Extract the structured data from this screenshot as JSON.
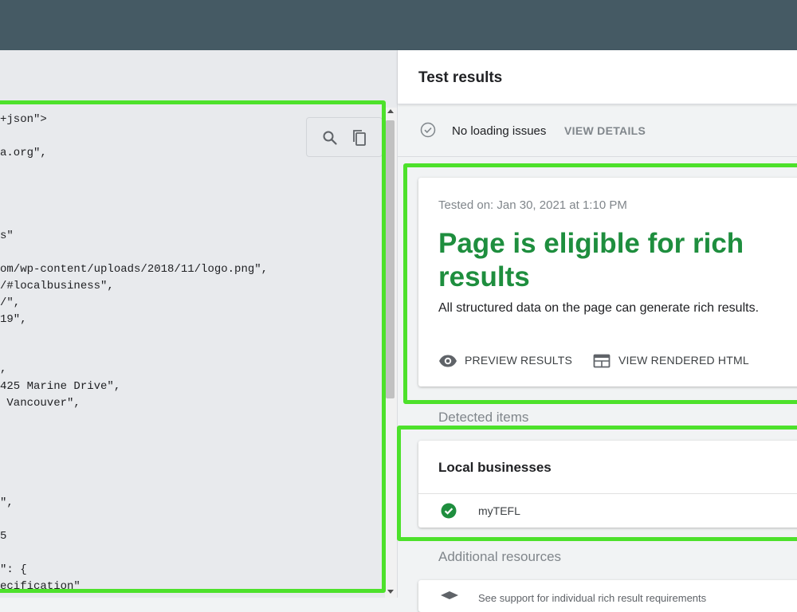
{
  "code": {
    "lines": [
      "+json\">",
      "a.org\",",
      "s\"",
      "om/wp-content/uploads/2018/11/logo.png\",",
      "/#localbusiness\",",
      "/\",",
      "19\",",
      ",",
      "425 Marine Drive\",",
      " Vancouver\",",
      "\",",
      "5",
      "\": {",
      "ecification\""
    ],
    "search_icon": "search-icon",
    "copy_icon": "copy-icon"
  },
  "results": {
    "title": "Test results",
    "loading_status": "No loading issues",
    "view_details": "VIEW DETAILS",
    "tested_on": "Tested on: Jan 30, 2021 at 1:10 PM",
    "eligible_title": "Page is eligible for rich results",
    "eligible_subtitle": "All structured data on the page can generate rich results.",
    "preview_results": "PREVIEW RESULTS",
    "view_rendered_html": "VIEW RENDERED HTML",
    "detected_items_label": "Detected items",
    "local_businesses_title": "Local businesses",
    "business_name": "myTEFL",
    "additional_resources_label": "Additional resources",
    "resource_text": "See support for individual rich result requirements"
  },
  "colors": {
    "topbar": "#455a64",
    "success_green": "#1e8e3e",
    "highlight": "#4de12b"
  }
}
